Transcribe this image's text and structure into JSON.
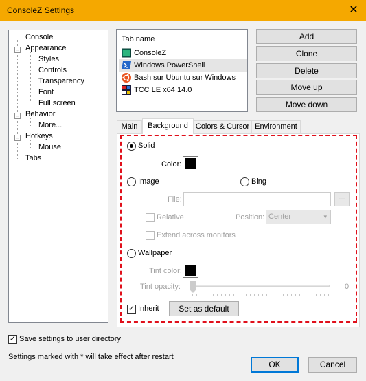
{
  "window": {
    "title": "ConsoleZ Settings",
    "close_glyph": "✕"
  },
  "tree": [
    {
      "label": "Console"
    },
    {
      "label": "Appearance"
    },
    {
      "label": "Styles"
    },
    {
      "label": "Controls"
    },
    {
      "label": "Transparency"
    },
    {
      "label": "Font"
    },
    {
      "label": "Full screen"
    },
    {
      "label": "Behavior"
    },
    {
      "label": "More..."
    },
    {
      "label": "Hotkeys"
    },
    {
      "label": "Mouse"
    },
    {
      "label": "Tabs"
    }
  ],
  "tablist": {
    "header": "Tab name",
    "items": [
      {
        "label": "ConsoleZ",
        "icon": "consolez-icon"
      },
      {
        "label": "Windows PowerShell",
        "icon": "powershell-icon"
      },
      {
        "label": "Bash sur Ubuntu sur Windows",
        "icon": "ubuntu-icon"
      },
      {
        "label": "TCC LE x64 14.0",
        "icon": "tcc-icon"
      }
    ]
  },
  "buttons": {
    "add": "Add",
    "clone": "Clone",
    "delete": "Delete",
    "move_up": "Move up",
    "move_down": "Move down"
  },
  "tabs": [
    "Main",
    "Background",
    "Colors & Cursor",
    "Environment"
  ],
  "background": {
    "solid": "Solid",
    "color_label": "Color:",
    "image": "Image",
    "bing": "Bing",
    "file_label": "File:",
    "browse": "...",
    "relative": "Relative",
    "position_label": "Position:",
    "position_value": "Center",
    "extend": "Extend across monitors",
    "wallpaper": "Wallpaper",
    "tint_color_label": "Tint color:",
    "tint_opacity_label": "Tint opacity:",
    "tint_opacity_value": "0",
    "inherit": "Inherit",
    "set_default": "Set as default",
    "swatch_color": "#000000"
  },
  "footer": {
    "save_settings": "Save settings to user directory",
    "restart_note": "Settings marked with * will take effect after restart",
    "ok": "OK",
    "cancel": "Cancel"
  }
}
